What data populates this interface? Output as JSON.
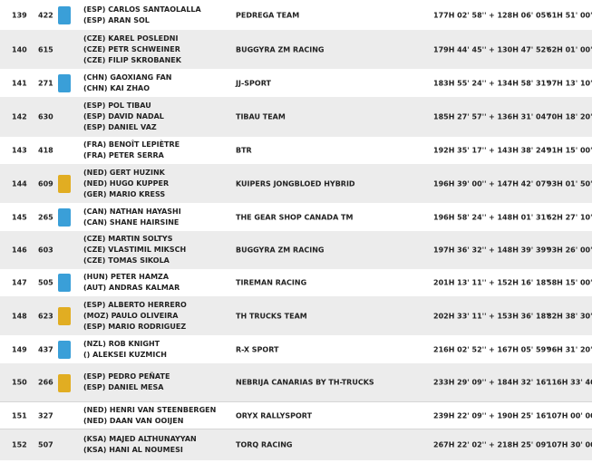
{
  "rows": [
    {
      "pos": "139",
      "num": "422",
      "badge": "blue",
      "crew": [
        "(ESP)  CARLOS SANTAOLALLA",
        "(ESP)  ARAN SOL"
      ],
      "team": "PEDREGA TEAM",
      "total": "177H 02' 58''",
      "gap": "+ 128H 06' 05''",
      "penalty": "61H 51' 00''"
    },
    {
      "pos": "140",
      "num": "615",
      "badge": "",
      "crew": [
        "(CZE)  KAREL POSLEDNI",
        "(CZE)  PETR SCHWEINER",
        "(CZE)  FILIP SKROBANEK"
      ],
      "team": "BUGGYRA ZM RACING",
      "total": "179H 44' 45''",
      "gap": "+ 130H 47' 52''",
      "penalty": "62H 01' 00''"
    },
    {
      "pos": "141",
      "num": "271",
      "badge": "blue",
      "crew": [
        "(CHN)  GAOXIANG FAN",
        "(CHN)  KAI ZHAO"
      ],
      "team": "JJ-SPORT",
      "total": "183H 55' 24''",
      "gap": "+ 134H 58' 31''",
      "penalty": "97H 13' 10''"
    },
    {
      "pos": "142",
      "num": "630",
      "badge": "",
      "crew": [
        "(ESP)  POL TIBAU",
        "(ESP)  DAVID NADAL",
        "(ESP)  DANIEL VAZ"
      ],
      "team": "TIBAU TEAM",
      "total": "185H 27' 57''",
      "gap": "+ 136H 31' 04''",
      "penalty": "70H 18' 20''"
    },
    {
      "pos": "143",
      "num": "418",
      "badge": "",
      "crew": [
        "(FRA)  BENOÎT LEPIÈTRE",
        "(FRA)  PETER SERRA"
      ],
      "team": "BTR",
      "total": "192H 35' 17''",
      "gap": "+ 143H 38' 24''",
      "penalty": "91H 15' 00''"
    },
    {
      "pos": "144",
      "num": "609",
      "badge": "gold",
      "crew": [
        "(NED)  GERT HUZINK",
        "(NED)  HUGO KUPPER",
        "(GER)  MARIO KRESS"
      ],
      "team": "KUIPERS JONGBLOED HYBRID",
      "total": "196H 39' 00''",
      "gap": "+ 147H 42' 07''",
      "penalty": "93H 01' 50''"
    },
    {
      "pos": "145",
      "num": "265",
      "badge": "blue",
      "crew": [
        "(CAN)  NATHAN HAYASHI",
        "(CAN)  SHANE HAIRSINE"
      ],
      "team": "THE GEAR SHOP CANADA TM",
      "total": "196H 58' 24''",
      "gap": "+ 148H 01' 31''",
      "penalty": "62H 27' 10''"
    },
    {
      "pos": "146",
      "num": "603",
      "badge": "",
      "crew": [
        "(CZE)  MARTIN SOLTYS",
        "(CZE)  VLASTIMIL MIKSCH",
        "(CZE)  TOMAS SIKOLA"
      ],
      "team": "BUGGYRA ZM RACING",
      "total": "197H 36' 32''",
      "gap": "+ 148H 39' 39''",
      "penalty": "93H 26' 00''"
    },
    {
      "pos": "147",
      "num": "505",
      "badge": "blue",
      "crew": [
        "(HUN)  PETER HAMZA",
        "(AUT)  ANDRAS KALMAR"
      ],
      "team": "TIREMAN RACING",
      "total": "201H 13' 11''",
      "gap": "+ 152H 16' 18''",
      "penalty": "58H 15' 00''"
    },
    {
      "pos": "148",
      "num": "623",
      "badge": "gold",
      "crew": [
        "(ESP)  ALBERTO HERRERO",
        "(MOZ)  PAULO OLIVEIRA",
        "(ESP)  MARIO RODRIGUEZ"
      ],
      "team": "TH TRUCKS TEAM",
      "total": "202H 33' 11''",
      "gap": "+ 153H 36' 18''",
      "penalty": "82H 38' 30''"
    },
    {
      "pos": "149",
      "num": "437",
      "badge": "blue",
      "crew": [
        "(NZL)  ROB KNIGHT",
        "()  ALEKSEI KUZMICH"
      ],
      "team": "R-X SPORT",
      "total": "216H 02' 52''",
      "gap": "+ 167H 05' 59''",
      "penalty": "96H 31' 20''"
    },
    {
      "pos": "150",
      "num": "266",
      "badge": "gold",
      "crew": [
        "(ESP)  PEDRO PEÑATE",
        "(ESP)  DANIEL MESA"
      ],
      "team": "NEBRIJA CANARIAS BY TH-TRUCKS",
      "total": "233H 29' 09''",
      "gap": "+ 184H 32' 16''",
      "penalty": "116H 33' 40''"
    },
    {
      "pos": "151",
      "num": "327",
      "badge": "",
      "crew": [
        "(NED)  HENRI VAN STEENBERGEN",
        "(NED)  DAAN VAN OOIJEN"
      ],
      "team": "ORYX RALLYSPORT",
      "total": "239H 22' 09''",
      "gap": "+ 190H 25' 16''",
      "penalty": "107H 00' 00''"
    },
    {
      "pos": "152",
      "num": "507",
      "badge": "",
      "crew": [
        "(KSA)  MAJED ALTHUNAYYAN",
        "(KSA)  HANI AL NOUMESI"
      ],
      "team": "TORQ RACING",
      "total": "267H 22' 02''",
      "gap": "+ 218H 25' 09''",
      "penalty": "107H 30' 00''"
    }
  ]
}
